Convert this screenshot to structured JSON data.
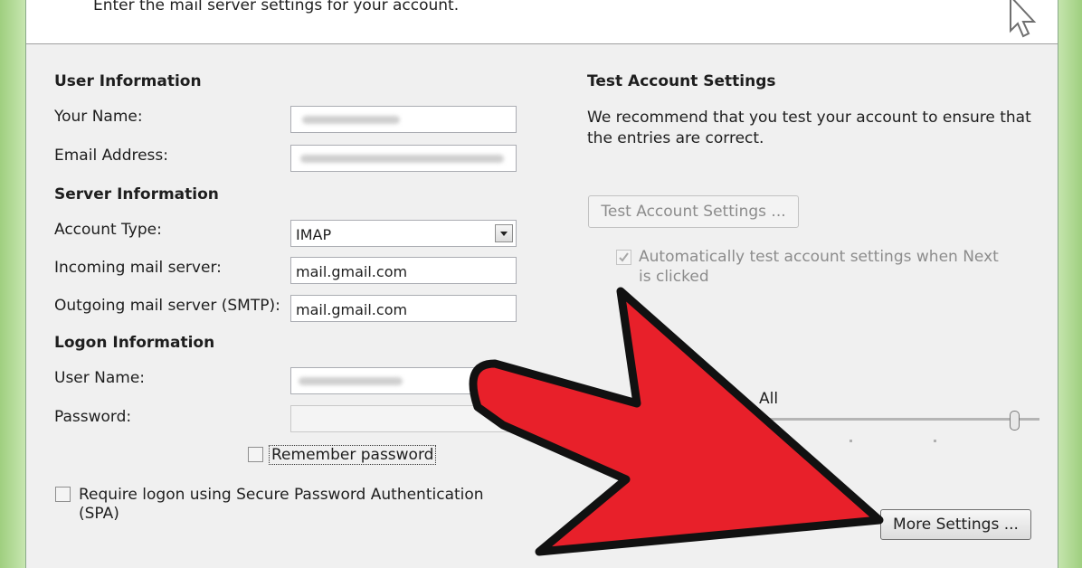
{
  "header": {
    "instruction": "Enter the mail server settings for your account."
  },
  "user_info": {
    "heading": "User Information",
    "your_name_label": "Your Name:",
    "email_label": "Email Address:"
  },
  "server_info": {
    "heading": "Server Information",
    "account_type_label": "Account Type:",
    "account_type_value": "IMAP",
    "incoming_label": "Incoming mail server:",
    "incoming_value": "mail.gmail.com",
    "outgoing_label": "Outgoing mail server (SMTP):",
    "outgoing_value": "mail.gmail.com"
  },
  "logon_info": {
    "heading": "Logon Information",
    "username_label": "User Name:",
    "password_label": "Password:",
    "remember_label": "Remember password",
    "spa_label_line1": "Require logon using Secure Password Authentication",
    "spa_label_line2": "(SPA)"
  },
  "test_settings": {
    "heading": "Test Account Settings",
    "desc_line1": "We recommend that you test your account to ensure that",
    "desc_line2": "the entries are correct.",
    "button_label": "Test Account Settings ...",
    "auto_test_line1": "Automatically test account settings when Next",
    "auto_test_line2": "is clicked",
    "all_label": "All"
  },
  "more_settings_label": "More Settings ...",
  "colors": {
    "arrow_fill": "#e8202a",
    "arrow_outline": "#111111"
  }
}
